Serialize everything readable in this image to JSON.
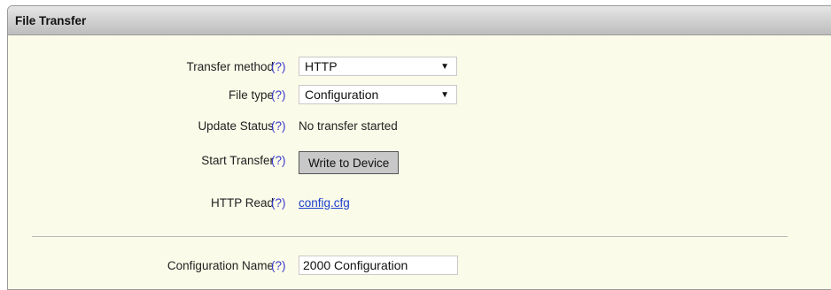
{
  "panel": {
    "title": "File Transfer"
  },
  "help_text": "(?)",
  "rows": {
    "transfer_method": {
      "label": "Transfer method",
      "value": "HTTP"
    },
    "file_type": {
      "label": "File type",
      "value": "Configuration"
    },
    "update_status": {
      "label": "Update Status",
      "value": "No transfer started"
    },
    "start_transfer": {
      "label": "Start Transfer",
      "button": "Write to Device"
    },
    "http_read": {
      "label": "HTTP Read",
      "link": "config.cfg"
    },
    "configuration_name": {
      "label": "Configuration Name",
      "value": "2000 Configuration"
    }
  },
  "icons": {
    "dropdown": "caret-down-icon"
  },
  "colors": {
    "panel_bg": "#fbfbe9",
    "help": "#3a3ad0",
    "link": "#1a3fcc",
    "header": "#c9c9c9"
  }
}
